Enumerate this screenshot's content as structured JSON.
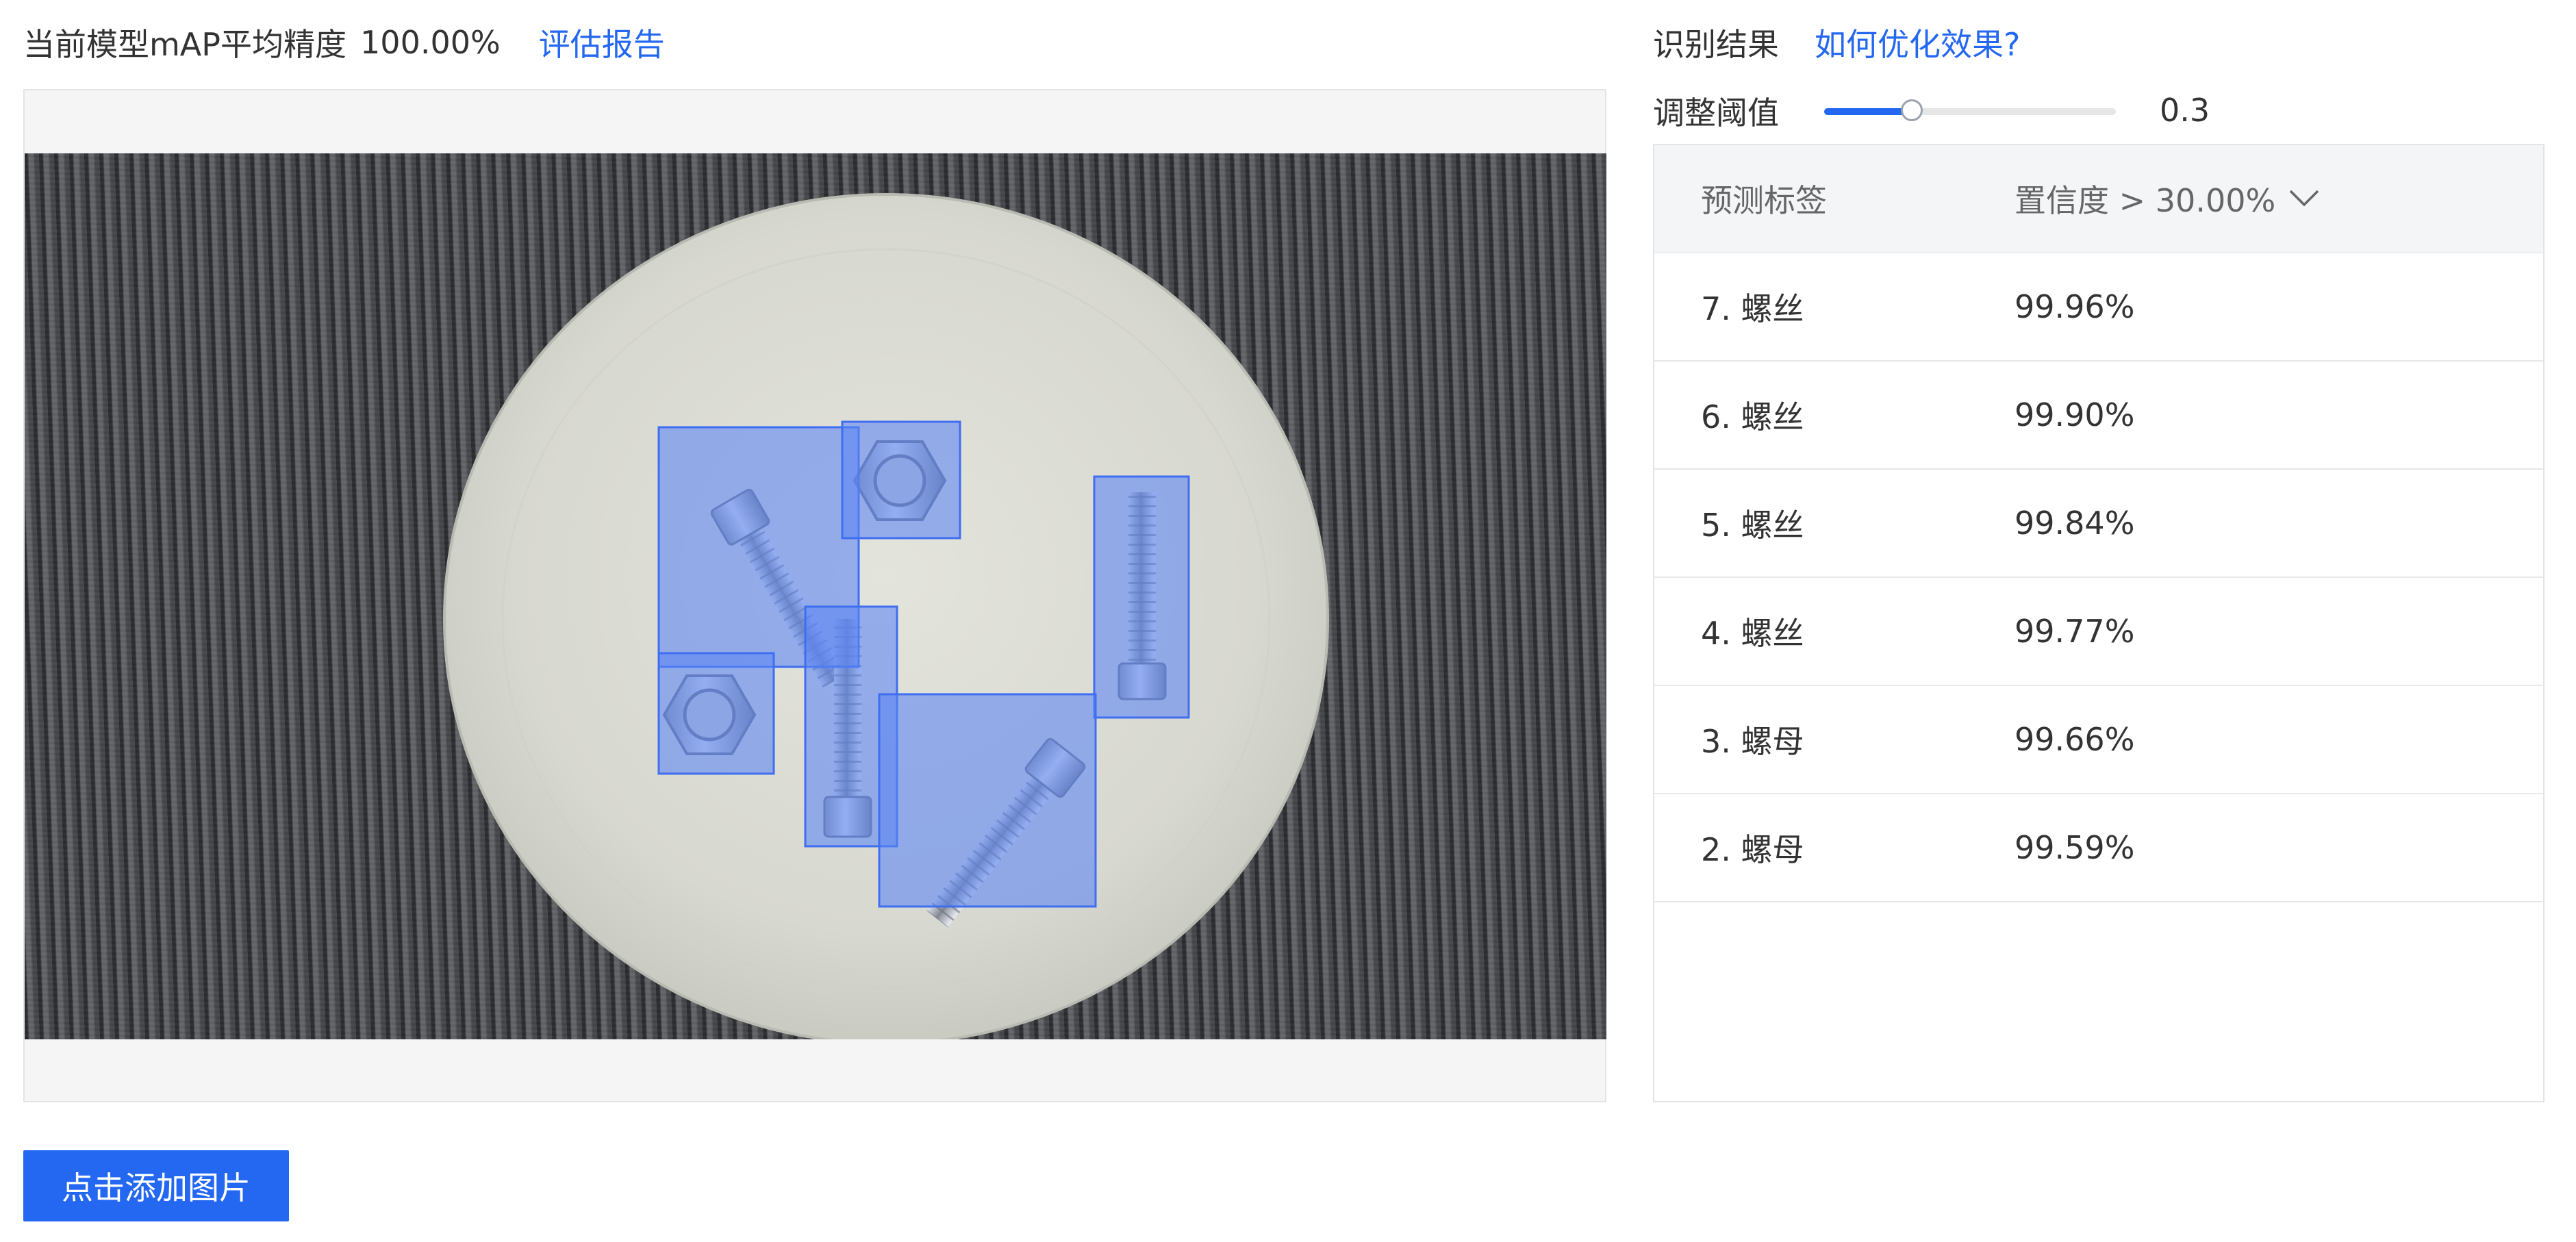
{
  "header": {
    "map_label": "当前模型mAP平均精度",
    "map_value": "100.00%",
    "report_link": "评估报告"
  },
  "upload_button": "点击添加图片",
  "results": {
    "title": "识别结果",
    "optimize_link": "如何优化效果?",
    "threshold_label": "调整阈值",
    "threshold_value": "0.3",
    "threshold_fraction": 0.3,
    "table": {
      "col_label": "预测标签",
      "col_confidence": "置信度 > 30.00%",
      "rows": [
        {
          "label": "7. 螺丝",
          "confidence": "99.96%"
        },
        {
          "label": "6. 螺丝",
          "confidence": "99.90%"
        },
        {
          "label": "5. 螺丝",
          "confidence": "99.84%"
        },
        {
          "label": "4. 螺丝",
          "confidence": "99.77%"
        },
        {
          "label": "3. 螺母",
          "confidence": "99.66%"
        },
        {
          "label": "2. 螺母",
          "confidence": "99.59%"
        }
      ]
    }
  },
  "colors": {
    "accent": "#2468f2",
    "box_fill": "#5b84f5",
    "box_stroke": "#3f6ef0"
  },
  "icons": {
    "dropdown": "chevron-down-icon"
  }
}
